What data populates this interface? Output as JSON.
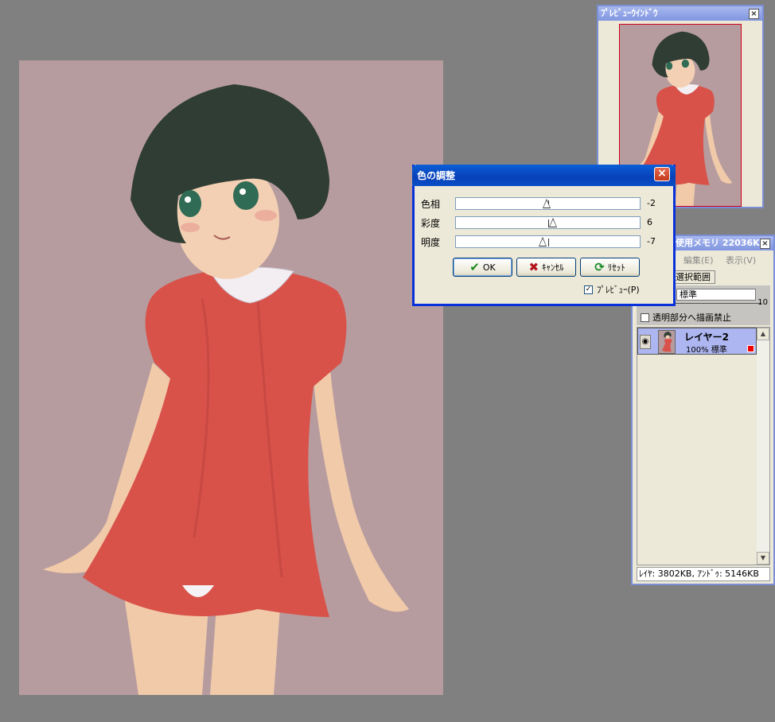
{
  "preview_window": {
    "title": "ﾌﾟﾚﾋﾞｭｰｳｲﾝﾄﾞｳ",
    "close_glyph": "×"
  },
  "color_dialog": {
    "title": "色の調整",
    "close_glyph": "×",
    "sliders": [
      {
        "label": "色相",
        "value": "-2",
        "level": -2
      },
      {
        "label": "彩度",
        "value": "6",
        "level": 6
      },
      {
        "label": "明度",
        "value": "-7",
        "level": -7
      }
    ],
    "ok_label": "OK",
    "cancel_label": "ｷｬﾝｾﾙ",
    "reset_label": "ﾘｾｯﾄ",
    "preview_label": "ﾌﾟﾚﾋﾞｭｰ(P)",
    "preview_checked": "✓"
  },
  "layer_window": {
    "title": "使用メモリ 22036K...",
    "close_glyph": "×",
    "menu_edit": "編集(E)",
    "menu_view": "表示(V)",
    "tab_selection": "選択範囲",
    "blend_mode": "標準",
    "opacity_max": "10",
    "lock_transparency_label": "透明部分へ描画禁止",
    "layers": [
      {
        "name": "レイヤー2",
        "opacity": "100%",
        "mode": "標準"
      }
    ],
    "status": "ﾚｲﾔ: 3802KB, ｱﾝﾄﾞｩ: 5146KB",
    "eye_glyph": "◉"
  },
  "colors": {
    "canvas_bg": "#b79c9f",
    "dress": "#d8524a",
    "hair": "#2f3d34",
    "skin": "#f0c9aa"
  }
}
